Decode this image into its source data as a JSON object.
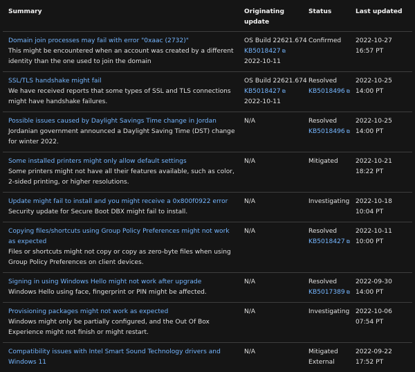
{
  "headers": {
    "summary": "Summary",
    "originating_update": "Originating update",
    "status": "Status",
    "last_updated": "Last updated"
  },
  "rows": [
    {
      "title": "Domain join processes may fail with error \"0xaac (2732)\"",
      "description": "This might be encountered when an account was created by a different identity than the one used to join the domain",
      "originating": "OS Build 22621.674",
      "originating_kb": "KB5018427",
      "originating_date": "2022-10-11",
      "status": "Confirmed",
      "status_kb": "",
      "updated_date": "2022-10-27",
      "updated_time": "16:57 PT"
    },
    {
      "title": "SSL/TLS handshake might fail",
      "description": "We have received reports that some types of SSL and TLS connections might have handshake failures.",
      "originating": "OS Build 22621.674",
      "originating_kb": "KB5018427",
      "originating_date": "2022-10-11",
      "status": "Resolved",
      "status_kb": "KB5018496",
      "updated_date": "2022-10-25",
      "updated_time": "14:00 PT"
    },
    {
      "title": "Possible issues caused by Daylight Savings Time change in Jordan",
      "description": "Jordanian government announced a Daylight Saving Time (DST) change for winter 2022.",
      "originating": "N/A",
      "originating_kb": "",
      "originating_date": "",
      "status": "Resolved",
      "status_kb": "KB5018496",
      "updated_date": "2022-10-25",
      "updated_time": "14:00 PT"
    },
    {
      "title": "Some installed printers might only allow default settings",
      "description": "Some printers might not have all their features available, such as color, 2-sided printing, or higher resolutions.",
      "originating": "N/A",
      "originating_kb": "",
      "originating_date": "",
      "status": "Mitigated",
      "status_kb": "",
      "updated_date": "2022-10-21",
      "updated_time": "18:22 PT"
    },
    {
      "title": "Update might fail to install and you might receive a 0x800f0922 error",
      "description": "Security update for Secure Boot DBX might fail to install.",
      "originating": "N/A",
      "originating_kb": "",
      "originating_date": "",
      "status": "Investigating",
      "status_kb": "",
      "updated_date": "2022-10-18",
      "updated_time": "10:04 PT"
    },
    {
      "title": "Copying files/shortcuts using Group Policy Preferences might not work as expected",
      "description": "Files or shortcuts might not copy or copy as zero-byte files when using Group Policy Preferences on client devices.",
      "originating": "N/A",
      "originating_kb": "",
      "originating_date": "",
      "status": "Resolved",
      "status_kb": "KB5018427",
      "updated_date": "2022-10-11",
      "updated_time": "10:00 PT"
    },
    {
      "title": "Signing in using Windows Hello might not work after upgrade",
      "description": "Windows Hello using face, fingerprint or PIN might be affected.",
      "originating": "N/A",
      "originating_kb": "",
      "originating_date": "",
      "status": "Resolved",
      "status_kb": "KB5017389",
      "updated_date": "2022-09-30",
      "updated_time": "14:00 PT"
    },
    {
      "title": "Provisioning packages might not work as expected",
      "description": "Windows might only be partially configured, and the Out Of Box Experience might not finish or might restart.",
      "originating": "N/A",
      "originating_kb": "",
      "originating_date": "",
      "status": "Investigating",
      "status_kb": "",
      "updated_date": "2022-10-06",
      "updated_time": "07:54 PT"
    },
    {
      "title": "Compatibility issues with Intel Smart Sound Technology drivers and Windows 11",
      "description": "",
      "originating": "N/A",
      "originating_kb": "",
      "originating_date": "",
      "status": "Mitigated External",
      "status_kb": "",
      "updated_date": "2022-09-22",
      "updated_time": "17:52 PT"
    }
  ],
  "icons": {
    "external_link": "external-link-icon",
    "external_glyph": "⧉"
  },
  "colors": {
    "background": "#151515",
    "link": "#75b6ff",
    "text": "#e1e1e1",
    "header": "#f2f2f2",
    "divider": "#3e3e3e"
  }
}
